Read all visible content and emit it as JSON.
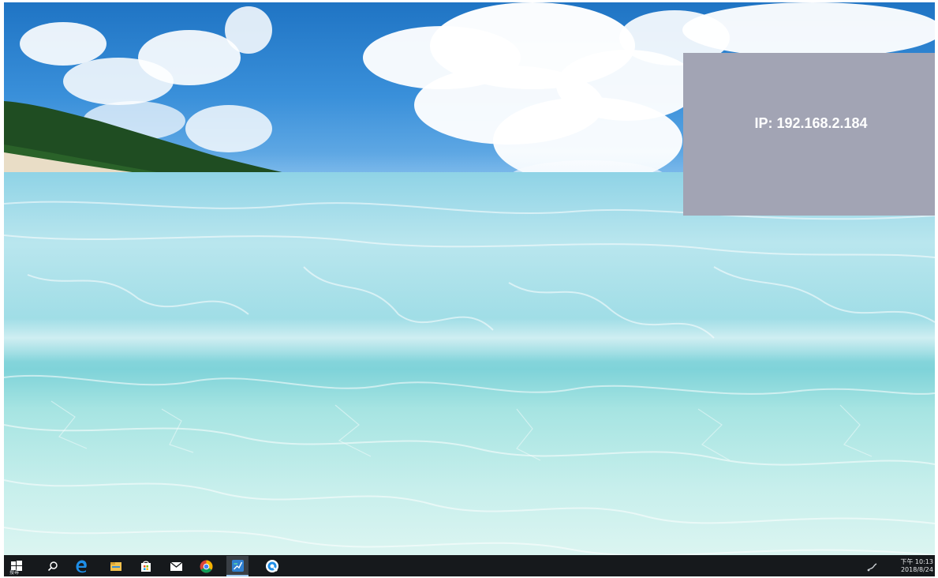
{
  "overlay": {
    "ip_text": "IP: 192.168.2.184"
  },
  "taskbar": {
    "start_label": "搜尋",
    "icons": [
      "windows-start-icon",
      "search-icon",
      "edge-icon",
      "file-explorer-icon",
      "store-icon",
      "mail-icon",
      "chrome-icon",
      "teamviewer-icon",
      "blue-circle-app-icon"
    ],
    "active_icon": "teamviewer-icon",
    "clock_time": "下午 10:13",
    "clock_date": "2018/8/24",
    "tray_icon": "network-icon",
    "background_color": "#16191c"
  },
  "colors": {
    "ip_panel": "#a2a4b4",
    "sky": "#2d8fd6",
    "sea": "#9fdde6"
  }
}
